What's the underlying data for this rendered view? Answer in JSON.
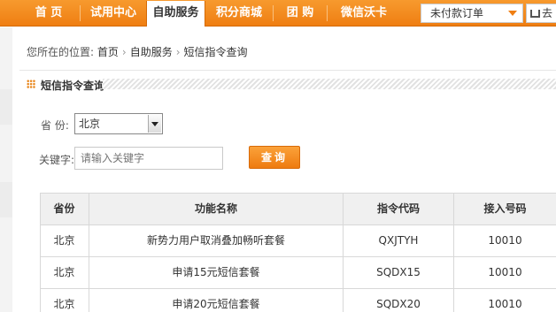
{
  "nav": {
    "items": [
      "首 页",
      "试用中心",
      "自助服务",
      "积分商城",
      "团 购",
      "微信沃卡"
    ],
    "active_index": 2,
    "order_select": "未付款订单",
    "cart_label": "去"
  },
  "breadcrumb": {
    "prefix": "您所在的位置:",
    "items": [
      "首页",
      "自助服务",
      "短信指令查询"
    ]
  },
  "section": {
    "title": "短信指令查询"
  },
  "form": {
    "province_label": "省 份:",
    "province_value": "北京",
    "keyword_label": "关键字:",
    "keyword_placeholder": "请输入关键字",
    "query_button": "查询"
  },
  "table": {
    "headers": [
      "省份",
      "功能名称",
      "指令代码",
      "接入号码"
    ],
    "rows": [
      [
        "北京",
        "新势力用户取消叠加畅听套餐",
        "QXJTYH",
        "10010"
      ],
      [
        "北京",
        "申请15元短信套餐",
        "SQDX15",
        "10010"
      ],
      [
        "北京",
        "申请20元短信套餐",
        "SQDX20",
        "10010"
      ]
    ]
  },
  "colors": {
    "brand_orange": "#ef7e12",
    "section_icon": "#e8851a"
  }
}
